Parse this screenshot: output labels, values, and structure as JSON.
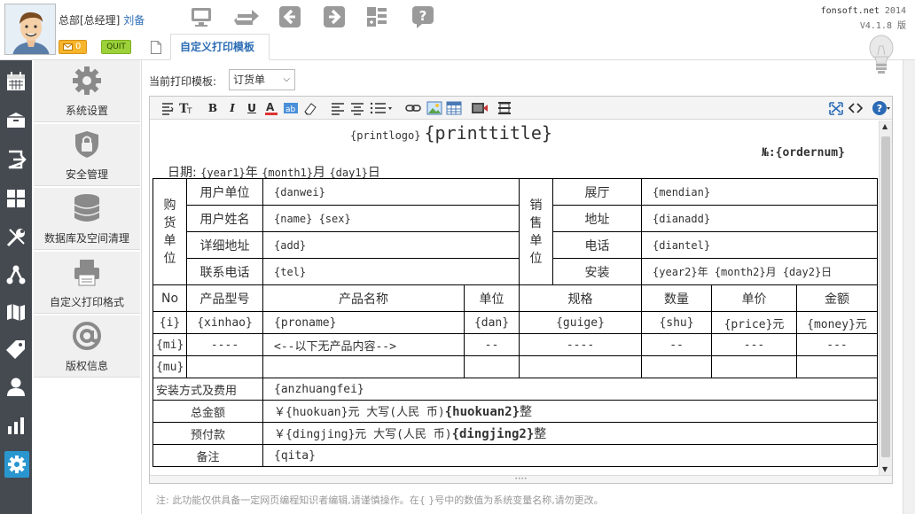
{
  "user": {
    "role": "总部[总经理]",
    "name": "刘备",
    "messages": "0",
    "quit_label": "QUIT"
  },
  "toolbar": {
    "icons": [
      "monitor-icon",
      "refresh-icon",
      "back-arrow-icon",
      "forward-arrow-icon",
      "layout-icon",
      "help-icon"
    ]
  },
  "brand": {
    "site": "fonsoft.net",
    "year": "2014",
    "version": "V4.1.8 版"
  },
  "tab": {
    "label": "自定义打印模板"
  },
  "sidebar_dark": {
    "icons": [
      "calendar-icon",
      "box-icon",
      "exit-icon",
      "grid-icon",
      "tools-icon",
      "network-icon",
      "map-icon",
      "tag-icon",
      "person-icon",
      "bar-chart-icon",
      "settings-icon"
    ]
  },
  "menu": {
    "items": [
      {
        "label": "系统设置",
        "icon": "gear-icon"
      },
      {
        "label": "安全管理",
        "icon": "shield-lock-icon"
      },
      {
        "label": "数据库及空间清理",
        "icon": "database-icon"
      },
      {
        "label": "自定义打印格式",
        "icon": "printer-icon"
      },
      {
        "label": "版权信息",
        "icon": "at-sign-icon"
      }
    ]
  },
  "template": {
    "label": "当前打印模板:",
    "selected": "订货单"
  },
  "editor": {
    "tools": [
      "format-icon",
      "font-size-icon",
      "bold-icon",
      "italic-icon",
      "underline-icon",
      "font-color-icon",
      "highlight-icon",
      "eraser-icon",
      "align-left-icon",
      "align-center-icon",
      "list-icon",
      "link-icon",
      "image-icon",
      "table-icon",
      "flash-icon",
      "hr-icon",
      "fullscreen-icon",
      "source-icon",
      "about-icon"
    ],
    "bold": "B",
    "italic": "I",
    "underline": "U"
  },
  "doc": {
    "printlogo": "{printlogo}",
    "printtitle": "{printtitle}",
    "order_label": "№:",
    "ordernum": "{ordernum}",
    "date_label": "日期:",
    "year1": "{year1}",
    "year_word": "年",
    "month1": "{month1}",
    "month_word": "月",
    "day1": "{day1}",
    "day_word": "日",
    "buyer_label": "购货单位",
    "seller_label": "销售单位",
    "buyer_fields": [
      {
        "label": "用户单位",
        "value": "{danwei}"
      },
      {
        "label": "用户姓名",
        "value": "{name}  {sex}"
      },
      {
        "label": "详细地址",
        "value": "{add}"
      },
      {
        "label": "联系电话",
        "value": "{tel}"
      }
    ],
    "seller_fields": [
      {
        "label": "展厅",
        "value": "{mendian}"
      },
      {
        "label": "地址",
        "value": "{dianadd}"
      },
      {
        "label": "电话",
        "value": "{diantel}"
      },
      {
        "label": "安装",
        "value": "{year2}年  {month2}月  {day2}日"
      }
    ],
    "columns": [
      "No",
      "产品型号",
      "产品名称",
      "单位",
      "规格",
      "数量",
      "单价",
      "金额"
    ],
    "row_item": [
      "{i}",
      "{xinhao}",
      "{proname}",
      "{dan}",
      "{guige}",
      "{shu}",
      "{price}元",
      "{money}元"
    ],
    "row_mi": [
      "{mi}",
      "----",
      "<--以下无产品内容-->",
      "--",
      "----",
      "--",
      "---",
      "---"
    ],
    "row_mu": [
      "{mu}",
      "",
      "",
      "",
      "",
      "",
      "",
      ""
    ],
    "install_label": "安装方式及费用",
    "install_value": "{anzhuangfei}",
    "total_label": "总金额",
    "total_a": "￥{huokuan}元 大写(人民 币)",
    "total_b": "{huokuan2}",
    "total_c": "整",
    "deposit_label": "预付款",
    "deposit_a": "￥{dingjing}元 大写(人民 币)",
    "deposit_b": "{dingjing2}",
    "deposit_c": "整",
    "remark_label": "备注",
    "remark_value": "{qita}"
  },
  "note": "注: 此功能仅供具备一定网页编程知识者编辑,请谨慎操作。在{  }号中的数值为系统变量名称,请勿更改。"
}
